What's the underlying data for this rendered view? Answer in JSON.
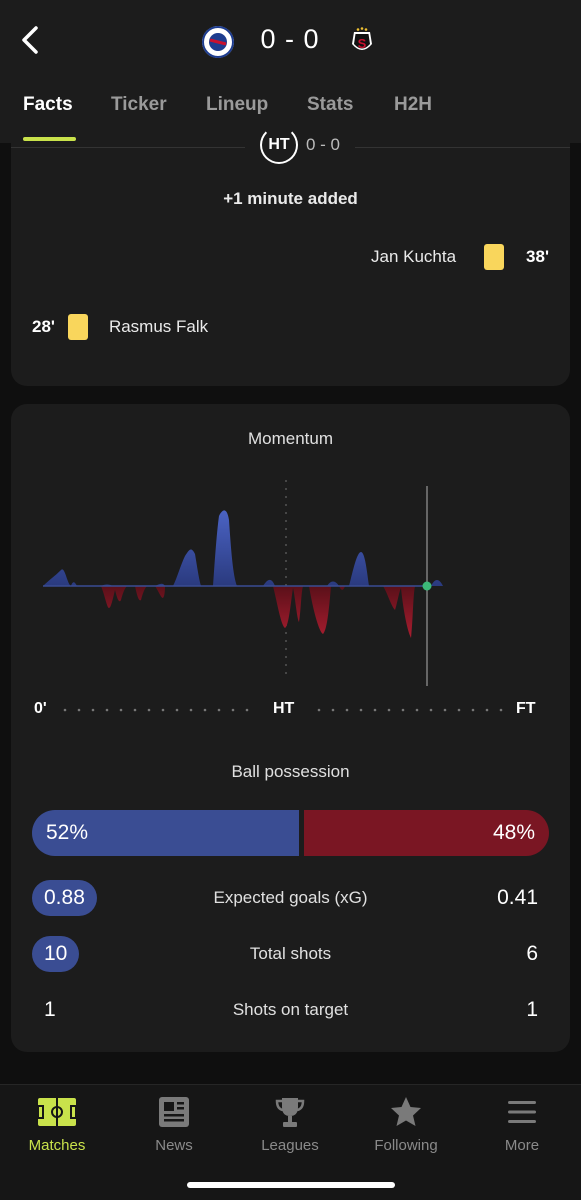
{
  "header": {
    "score": "0 - 0",
    "home_crest": "fc-copenhagen-crest",
    "away_crest": "sparta-prague-crest"
  },
  "tabs": [
    {
      "label": "Facts",
      "active": true
    },
    {
      "label": "Ticker",
      "active": false
    },
    {
      "label": "Lineup",
      "active": false
    },
    {
      "label": "Stats",
      "active": false
    },
    {
      "label": "H2H",
      "active": false
    }
  ],
  "events": {
    "ht_label": "HT",
    "ht_score": "0 - 0",
    "added_time": "+1 minute added",
    "list": [
      {
        "side": "away",
        "player": "Jan Kuchta",
        "minute": "38'",
        "type": "yellow-card"
      },
      {
        "side": "home",
        "player": "Rasmus Falk",
        "minute": "28'",
        "type": "yellow-card"
      }
    ]
  },
  "stats": {
    "momentum_title": "Momentum",
    "timeline": {
      "start": "0'",
      "mid": "HT",
      "end": "FT"
    },
    "possession_title": "Ball possession",
    "possession": {
      "home": "52%",
      "away": "48%",
      "home_value": 52,
      "away_value": 48
    },
    "rows": [
      {
        "label": "Expected goals (xG)",
        "home": "0.88",
        "away": "0.41",
        "home_highlight": true
      },
      {
        "label": "Total shots",
        "home": "10",
        "away": "6",
        "home_highlight": true
      },
      {
        "label": "Shots on target",
        "home": "1",
        "away": "1",
        "home_highlight": false
      }
    ]
  },
  "colors": {
    "accent": "#c9e24b",
    "home": "#3a4d93",
    "away": "#7a1623",
    "yellow_card": "#f9d65c"
  },
  "nav": [
    {
      "label": "Matches",
      "icon": "pitch-icon",
      "active": true
    },
    {
      "label": "News",
      "icon": "newspaper-icon",
      "active": false
    },
    {
      "label": "Leagues",
      "icon": "trophy-icon",
      "active": false
    },
    {
      "label": "Following",
      "icon": "star-icon",
      "active": false
    },
    {
      "label": "More",
      "icon": "menu-icon",
      "active": false
    }
  ]
}
